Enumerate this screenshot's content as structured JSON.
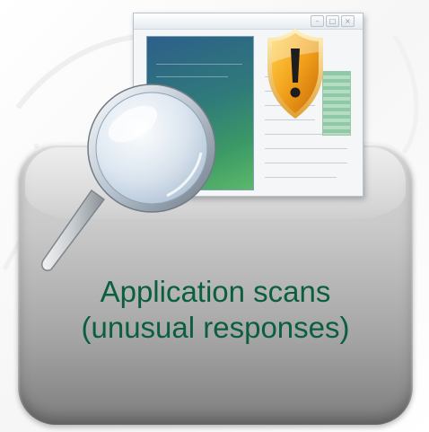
{
  "caption": {
    "line1": "Application scans",
    "line2": "(unusual responses)"
  },
  "colors": {
    "caption_text": "#0b5f3f",
    "card_top": "#d9d9d9",
    "card_bottom": "#7d7d7d",
    "shield_orange": "#f0a020"
  },
  "icons": {
    "window": "application-window-icon",
    "shield": "warning-shield-icon",
    "magnifier": "magnifying-glass-icon"
  }
}
